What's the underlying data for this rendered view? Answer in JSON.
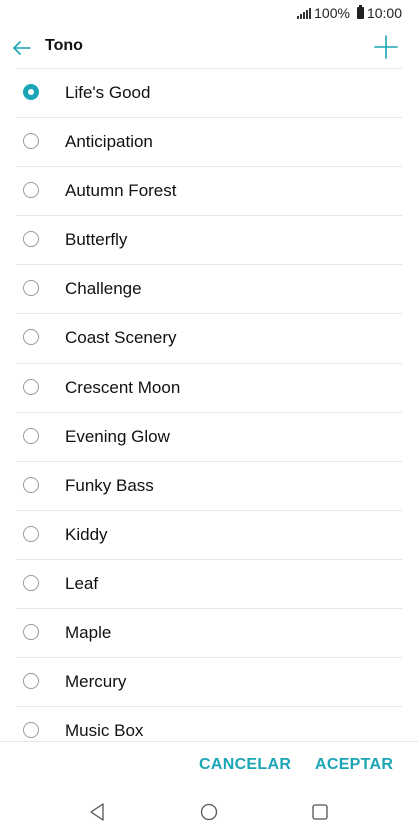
{
  "status_bar": {
    "battery_percent": "100%",
    "time": "10:00",
    "icons": [
      "signal-icon",
      "battery-icon"
    ]
  },
  "app_bar": {
    "title": "Tono",
    "back_icon": "arrow-left-icon",
    "add_icon": "plus-icon"
  },
  "ringtones": [
    {
      "label": "Life's Good",
      "selected": true
    },
    {
      "label": "Anticipation",
      "selected": false
    },
    {
      "label": "Autumn Forest",
      "selected": false
    },
    {
      "label": "Butterfly",
      "selected": false
    },
    {
      "label": "Challenge",
      "selected": false
    },
    {
      "label": "Coast Scenery",
      "selected": false
    },
    {
      "label": "Crescent Moon",
      "selected": false
    },
    {
      "label": "Evening Glow",
      "selected": false
    },
    {
      "label": "Funky Bass",
      "selected": false
    },
    {
      "label": "Kiddy",
      "selected": false
    },
    {
      "label": "Leaf",
      "selected": false
    },
    {
      "label": "Maple",
      "selected": false
    },
    {
      "label": "Mercury",
      "selected": false
    },
    {
      "label": "Music Box",
      "selected": false
    }
  ],
  "actions": {
    "cancel_label": "CANCELAR",
    "accept_label": "ACEPTAR"
  },
  "nav_bar": {
    "icons": [
      "nav-back-icon",
      "nav-home-icon",
      "nav-recents-icon"
    ]
  },
  "colors": {
    "accent": "#1aa4b5",
    "divider": "#e6e6e6",
    "text": "#111111",
    "radio_border": "#9a9a9a"
  }
}
